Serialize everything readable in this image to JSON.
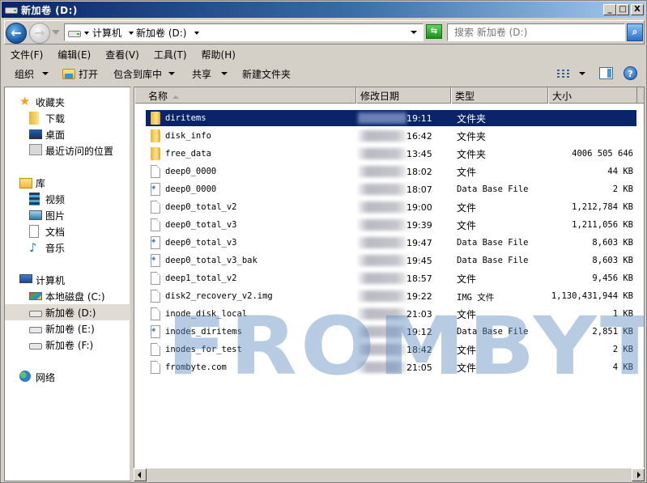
{
  "window": {
    "title": "新加卷 (D:)",
    "controls": {
      "minimize": "_",
      "maximize": "□",
      "close": "X"
    }
  },
  "address": {
    "crumbs": [
      "计算机",
      "新加卷 (D:)"
    ],
    "search_placeholder": "搜索 新加卷 (D:)"
  },
  "menu": {
    "items": [
      "文件(F)",
      "编辑(E)",
      "查看(V)",
      "工具(T)",
      "帮助(H)"
    ]
  },
  "commands": {
    "organize": "组织",
    "open": "打开",
    "include_in_library": "包含到库中",
    "share": "共享",
    "new_folder": "新建文件夹",
    "help": "?"
  },
  "nav": {
    "favorites": {
      "label": "收藏夹",
      "items": [
        "下载",
        "桌面",
        "最近访问的位置"
      ]
    },
    "libraries": {
      "label": "库",
      "items": [
        "视频",
        "图片",
        "文档",
        "音乐"
      ]
    },
    "computer": {
      "label": "计算机",
      "items": [
        "本地磁盘 (C:)",
        "新加卷 (D:)",
        "新加卷 (E:)",
        "新加卷 (F:)"
      ],
      "selected": "新加卷 (D:)"
    },
    "network": {
      "label": "网络"
    }
  },
  "list": {
    "columns": {
      "name": "名称",
      "date": "修改日期",
      "type": "类型",
      "size": "大小"
    },
    "sort_column": "名称",
    "rows": [
      {
        "name": "diritems",
        "time": "19:11",
        "type": "文件夹",
        "size": "",
        "icon": "folder",
        "selected": true
      },
      {
        "name": "disk_info",
        "time": "16:42",
        "type": "文件夹",
        "size": "",
        "icon": "folder"
      },
      {
        "name": "free_data",
        "time": "13:45",
        "type": "文件夹",
        "size": "4006 505 646",
        "icon": "folder"
      },
      {
        "name": "deep0_0000",
        "time": "18:02",
        "type": "文件",
        "size": "44 KB",
        "icon": "file"
      },
      {
        "name": "deep0_0000",
        "time": "18:07",
        "type": "Data Base File",
        "size": "2 KB",
        "icon": "db"
      },
      {
        "name": "deep0_total_v2",
        "time": "19:00",
        "type": "文件",
        "size": "1,212,784 KB",
        "icon": "file"
      },
      {
        "name": "deep0_total_v3",
        "time": "19:39",
        "type": "文件",
        "size": "1,211,056 KB",
        "icon": "file"
      },
      {
        "name": "deep0_total_v3",
        "time": "19:47",
        "type": "Data Base File",
        "size": "8,603 KB",
        "icon": "db"
      },
      {
        "name": "deep0_total_v3_bak",
        "time": "19:45",
        "type": "Data Base File",
        "size": "8,603 KB",
        "icon": "db"
      },
      {
        "name": "deep1_total_v2",
        "time": "18:57",
        "type": "文件",
        "size": "9,456 KB",
        "icon": "file"
      },
      {
        "name": "disk2_recovery_v2.img",
        "time": "19:22",
        "type": "IMG 文件",
        "size": "1,130,431,944 KB",
        "icon": "file"
      },
      {
        "name": "inode_disk_local",
        "time": "21:03",
        "type": "文件",
        "size": "1 KB",
        "icon": "file"
      },
      {
        "name": "inodes_diritems",
        "time": "19:12",
        "type": "Data Base File",
        "size": "2,851 KB",
        "icon": "db"
      },
      {
        "name": "inodes_for_test",
        "time": "18:42",
        "type": "文件",
        "size": "2 KB",
        "icon": "file"
      },
      {
        "name": "frombyte.com",
        "time": "21:05",
        "type": "文件",
        "size": "4 KB",
        "icon": "file"
      }
    ]
  },
  "watermark": {
    "text": "FROMBYTE",
    "mark": "®"
  },
  "colors": {
    "selection": "#0a246a",
    "title_start": "#0a246a",
    "title_end": "#a6caf0",
    "watermark": "#5f8cbe"
  }
}
